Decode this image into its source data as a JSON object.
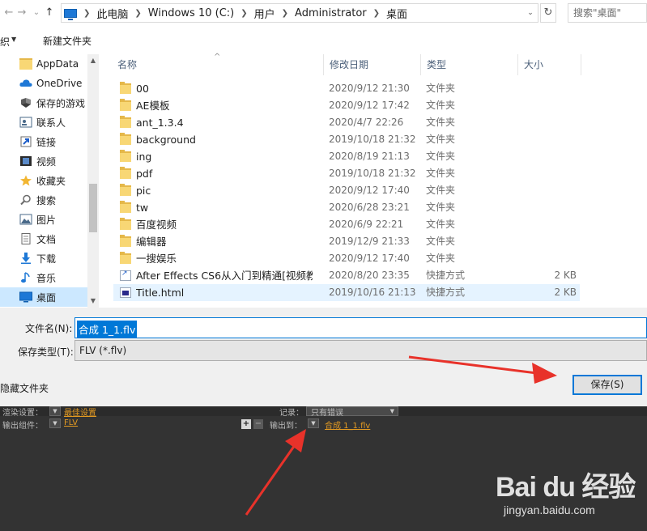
{
  "address_bar": {
    "back": "←",
    "forward": "→",
    "recent": "⌄",
    "up": "↑",
    "crumbs": [
      "此电脑",
      "Windows 10 (C:)",
      "用户",
      "Administrator",
      "桌面"
    ],
    "dropdown": "⌄",
    "refresh": "↻",
    "search_placeholder": "搜索\"桌面\""
  },
  "toolbar": {
    "organize": "织",
    "organize_arrow": "▼",
    "new_folder": "新建文件夹"
  },
  "nav_pane": {
    "items": [
      {
        "label": "AppData",
        "icon": "folder-icon"
      },
      {
        "label": "OneDrive",
        "icon": "cloud-icon"
      },
      {
        "label": "保存的游戏",
        "icon": "game-icon"
      },
      {
        "label": "联系人",
        "icon": "contacts-icon"
      },
      {
        "label": "链接",
        "icon": "link-icon"
      },
      {
        "label": "视频",
        "icon": "video-icon"
      },
      {
        "label": "收藏夹",
        "icon": "star-icon"
      },
      {
        "label": "搜索",
        "icon": "search-icon"
      },
      {
        "label": "图片",
        "icon": "picture-icon"
      },
      {
        "label": "文档",
        "icon": "document-icon"
      },
      {
        "label": "下载",
        "icon": "download-icon"
      },
      {
        "label": "音乐",
        "icon": "music-icon"
      },
      {
        "label": "桌面",
        "icon": "desktop-icon"
      }
    ],
    "scroll_up": "▲",
    "scroll_down": "▼"
  },
  "file_list": {
    "columns": {
      "name": "名称",
      "date": "修改日期",
      "type": "类型",
      "size": "大小"
    },
    "sort_caret": "^",
    "rows": [
      {
        "name": "00",
        "date": "2020/9/12 21:30",
        "type": "文件夹",
        "size": "",
        "icon": "folder"
      },
      {
        "name": "AE模板",
        "date": "2020/9/12 17:42",
        "type": "文件夹",
        "size": "",
        "icon": "folder"
      },
      {
        "name": "ant_1.3.4",
        "date": "2020/4/7 22:26",
        "type": "文件夹",
        "size": "",
        "icon": "folder"
      },
      {
        "name": "background",
        "date": "2019/10/18 21:32",
        "type": "文件夹",
        "size": "",
        "icon": "folder"
      },
      {
        "name": "ing",
        "date": "2020/8/19 21:13",
        "type": "文件夹",
        "size": "",
        "icon": "folder"
      },
      {
        "name": "pdf",
        "date": "2019/10/18 21:32",
        "type": "文件夹",
        "size": "",
        "icon": "folder"
      },
      {
        "name": "pic",
        "date": "2020/9/12 17:40",
        "type": "文件夹",
        "size": "",
        "icon": "folder"
      },
      {
        "name": "tw",
        "date": "2020/6/28 23:21",
        "type": "文件夹",
        "size": "",
        "icon": "folder"
      },
      {
        "name": "百度视频",
        "date": "2020/6/9 22:21",
        "type": "文件夹",
        "size": "",
        "icon": "folder"
      },
      {
        "name": "编辑器",
        "date": "2019/12/9 21:33",
        "type": "文件夹",
        "size": "",
        "icon": "folder"
      },
      {
        "name": "一搜娱乐",
        "date": "2020/9/12 17:40",
        "type": "文件夹",
        "size": "",
        "icon": "folder"
      },
      {
        "name": "After Effects CS6从入门到精通[视频教...",
        "date": "2020/8/20 23:35",
        "type": "快捷方式",
        "size": "2 KB",
        "icon": "shortcut"
      },
      {
        "name": "Title.html",
        "date": "2019/10/16 21:13",
        "type": "快捷方式",
        "size": "2 KB",
        "icon": "html",
        "selected": true
      }
    ]
  },
  "save_panel": {
    "filename_label": "文件名(N):",
    "filename_value": "合成 1_1.flv",
    "filetype_label": "保存类型(T):",
    "filetype_value": "FLV (*.flv)",
    "hide_folders": "隐藏文件夹",
    "save_button": "保存(S)"
  },
  "ae_panel": {
    "render_settings_label": "渲染设置：",
    "render_settings_value": "最佳设置",
    "log_label": "记录：",
    "log_value": "只有错误",
    "output_module_label": "输出组件：",
    "output_module_value": "FLV",
    "output_to_label": "输出到：",
    "output_to_value": "合成 1_1.flv",
    "plus": "+",
    "minus": "−"
  },
  "watermark": {
    "text": "Bai du 经验",
    "url": "jingyan.baidu.com"
  },
  "colors": {
    "accent": "#0078d7",
    "selection": "#cce8ff",
    "arrow_red": "#e8322a",
    "ae_orange": "#e39a22"
  }
}
